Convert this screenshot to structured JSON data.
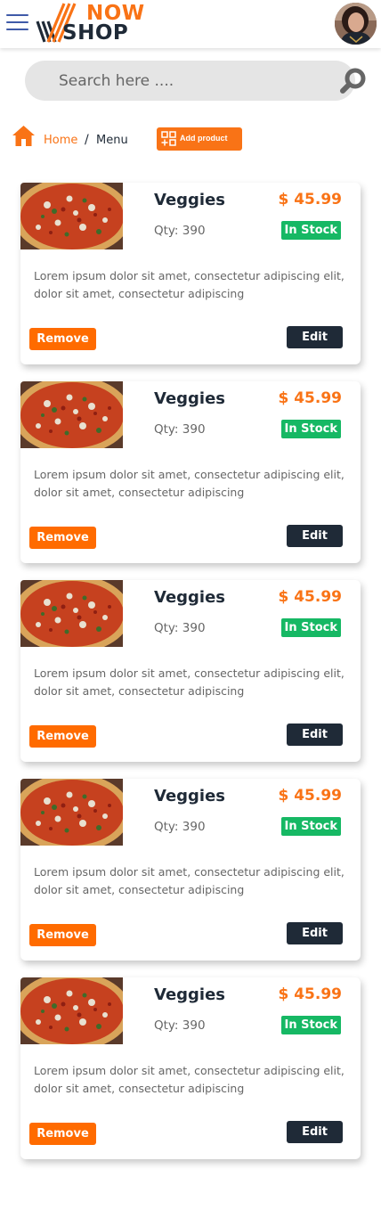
{
  "header": {
    "logo_now": "NOW",
    "logo_shop": "SHOP",
    "icons": {
      "menu": "hamburger-icon",
      "avatar": "user-avatar"
    }
  },
  "search": {
    "placeholder": "Search here ....",
    "icon": "search-icon"
  },
  "breadcrumb": {
    "home": "Home",
    "separator": "/",
    "current": "Menu",
    "icon": "home-icon"
  },
  "add_product": {
    "label": "Add product",
    "icon": "add-grid-icon"
  },
  "colors": {
    "accent": "#f97316",
    "remove": "#ff6b00",
    "dark": "#1f2a37",
    "in_stock": "#16b864",
    "search_bg": "#e5e5e5"
  },
  "products": [
    {
      "name": "Veggies",
      "price": "$ 45.99",
      "qty": "Qty: 390",
      "stock": "In Stock",
      "description": "Lorem ipsum dolor sit amet, consectetur adipiscing elit, dolor sit amet, consectetur adipiscing",
      "remove_label": "Remove",
      "edit_label": "Edit"
    },
    {
      "name": "Veggies",
      "price": "$ 45.99",
      "qty": "Qty: 390",
      "stock": "In Stock",
      "description": "Lorem ipsum dolor sit amet, consectetur adipiscing elit, dolor sit amet, consectetur adipiscing",
      "remove_label": "Remove",
      "edit_label": "Edit"
    },
    {
      "name": "Veggies",
      "price": "$ 45.99",
      "qty": "Qty: 390",
      "stock": "In Stock",
      "description": "Lorem ipsum dolor sit amet, consectetur adipiscing elit, dolor sit amet, consectetur adipiscing",
      "remove_label": "Remove",
      "edit_label": "Edit"
    },
    {
      "name": "Veggies",
      "price": "$ 45.99",
      "qty": "Qty: 390",
      "stock": "In Stock",
      "description": "Lorem ipsum dolor sit amet, consectetur adipiscing elit, dolor sit amet, consectetur adipiscing",
      "remove_label": "Remove",
      "edit_label": "Edit"
    },
    {
      "name": "Veggies",
      "price": "$ 45.99",
      "qty": "Qty: 390",
      "stock": "In Stock",
      "description": "Lorem ipsum dolor sit amet, consectetur adipiscing elit, dolor sit amet, consectetur adipiscing",
      "remove_label": "Remove",
      "edit_label": "Edit"
    }
  ]
}
